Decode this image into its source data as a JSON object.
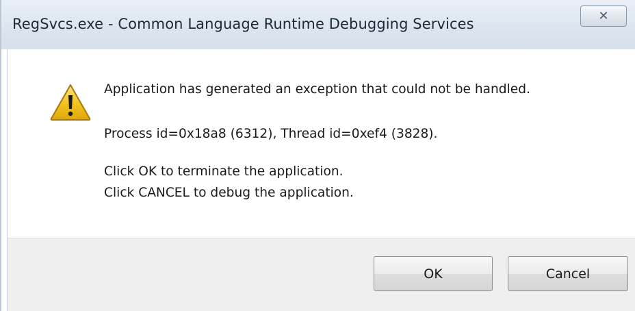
{
  "window": {
    "title": "RegSvcs.exe - Common Language Runtime Debugging Services",
    "close_glyph": "✕"
  },
  "message": {
    "icon": "warning-icon",
    "line1": "Application has generated an exception that could not be handled.",
    "line2": "Process id=0x18a8 (6312), Thread id=0xef4 (3828).",
    "line3": "Click OK to terminate the application.",
    "line4": "Click CANCEL to debug the application."
  },
  "buttons": {
    "ok_label": "OK",
    "cancel_label": "Cancel"
  },
  "colors": {
    "warning_fill": "#f2c31a",
    "warning_border": "#b8860b"
  }
}
